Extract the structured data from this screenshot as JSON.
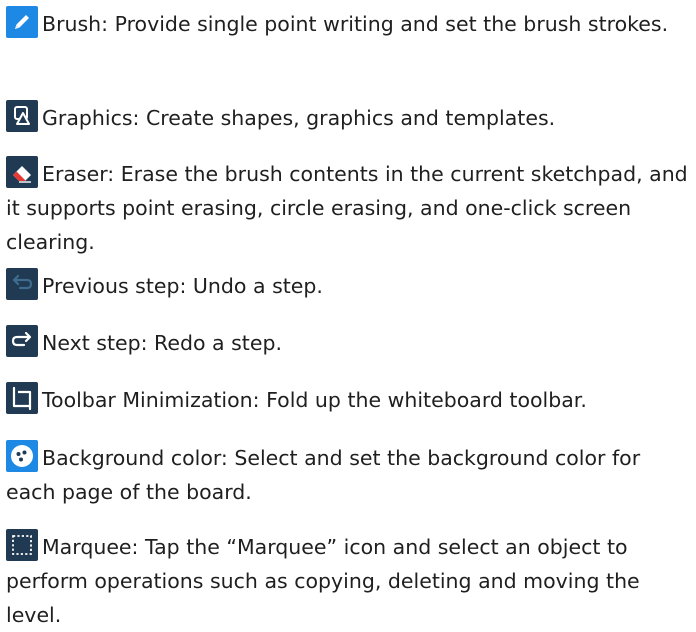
{
  "items": [
    {
      "icon": "brush-pencil-icon",
      "text": "Brush: Provide single point writing and set the brush strokes."
    },
    {
      "icon": "graphics-shapes-icon",
      "text": "Graphics: Create shapes, graphics and templates."
    },
    {
      "icon": "eraser-icon",
      "text": "Eraser: Erase the brush contents in the current sketchpad, and it supports point erasing, circle erasing, and one-click screen clearing."
    },
    {
      "icon": "undo-arrow-icon",
      "text": "Previous step: Undo a step."
    },
    {
      "icon": "redo-arrow-icon",
      "text": "Next step: Redo a step."
    },
    {
      "icon": "minimize-toolbar-icon",
      "text": "Toolbar Minimization: Fold up the whiteboard toolbar."
    },
    {
      "icon": "palette-icon",
      "text": "Background color: Select and set the background color for each page of the board."
    },
    {
      "icon": "marquee-selection-icon",
      "text": "Marquee: Tap the “Marquee” icon and select an object to perform operations such as copying, deleting and moving the level."
    }
  ],
  "colors": {
    "brush_icon_bg": "#1e88e5",
    "dark_icon_bg": "#1f3a52",
    "text": "#1f1f1f"
  }
}
